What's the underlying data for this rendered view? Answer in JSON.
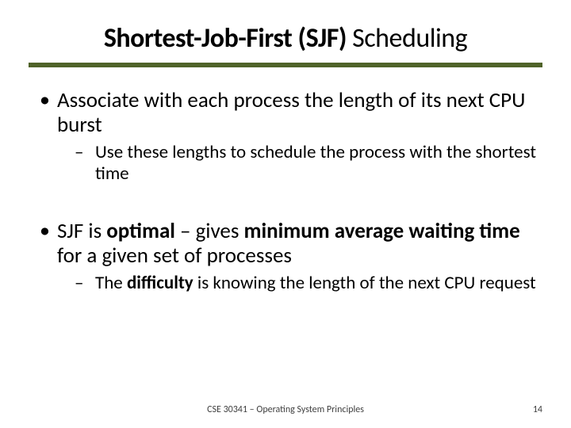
{
  "title": {
    "bold_part": "Shortest-Job-First (SJF)",
    "rest": " Scheduling"
  },
  "bullets": [
    {
      "text": "Associate with each process the length of its next CPU burst",
      "sub": [
        {
          "text": " Use these lengths to schedule the process with the shortest time"
        }
      ]
    },
    {
      "pre": "SJF is ",
      "bold1": "optimal",
      "mid": " – gives ",
      "bold2": "minimum average waiting time",
      "post": " for a given set of processes",
      "sub": [
        {
          "pre": "The ",
          "bold": "difficulty",
          "post": " is knowing the length of the next CPU request"
        }
      ]
    }
  ],
  "footer": {
    "course": "CSE 30341 – Operating System Principles",
    "page": "14"
  }
}
